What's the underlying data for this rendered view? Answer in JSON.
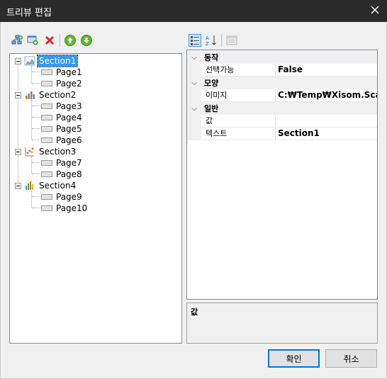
{
  "window": {
    "title": "트리뷰 편집"
  },
  "toolbar": {
    "left": [
      {
        "icon": "add-section-icon"
      },
      {
        "icon": "add-page-icon"
      },
      {
        "icon": "delete-icon"
      },
      {
        "icon": "move-up-icon"
      },
      {
        "icon": "move-down-icon"
      }
    ],
    "right": [
      {
        "icon": "categorized-icon"
      },
      {
        "icon": "alphabetical-icon"
      },
      {
        "icon": "property-pages-icon"
      }
    ]
  },
  "tree": {
    "sections": [
      {
        "label": "Section1",
        "icon": "area-chart-icon",
        "pages": [
          "Page1",
          "Page2"
        ]
      },
      {
        "label": "Section2",
        "icon": "bar-chart-icon",
        "pages": [
          "Page3",
          "Page4",
          "Page5",
          "Page6"
        ]
      },
      {
        "label": "Section3",
        "icon": "scatter-chart-icon",
        "pages": [
          "Page7",
          "Page8"
        ]
      },
      {
        "label": "Section4",
        "icon": "column-chart-icon",
        "pages": [
          "Page9",
          "Page10"
        ]
      }
    ],
    "selected": "Section1"
  },
  "property_grid": {
    "categories": [
      {
        "name": "동작",
        "props": [
          {
            "name": "선택가능",
            "value": "False"
          }
        ]
      },
      {
        "name": "모양",
        "props": [
          {
            "name": "이미지",
            "value": "C:₩Temp₩Xisom.Scada"
          }
        ]
      },
      {
        "name": "일반",
        "props": [
          {
            "name": "값",
            "value": ""
          },
          {
            "name": "텍스트",
            "value": "Section1"
          }
        ]
      }
    ],
    "description_title": "값"
  },
  "buttons": {
    "ok": "확인",
    "cancel": "취소"
  },
  "colors": {
    "titlebar": "#2b2b2b",
    "selection": "#3399ff",
    "accent": "#0078d7"
  }
}
